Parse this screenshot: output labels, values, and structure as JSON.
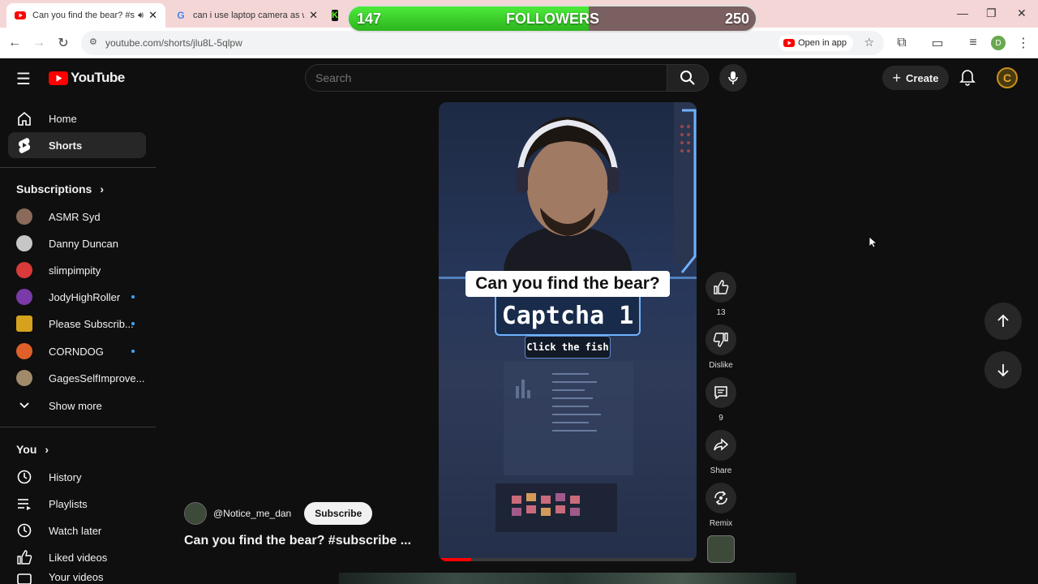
{
  "browser": {
    "tabs": [
      {
        "title": "Can you find the bear? #sub"
      },
      {
        "title": "can i use laptop camera as web"
      }
    ],
    "url": "youtube.com/shorts/jlu8L-5qlpw",
    "open_in_app": "Open in app",
    "profile_initial": "D"
  },
  "followers": {
    "current": "147",
    "label": "FOLLOWERS",
    "goal": "250",
    "progress": 0.59
  },
  "youtube": {
    "logo": "YouTube",
    "search_placeholder": "Search",
    "create_label": "Create"
  },
  "sidebar": {
    "main": [
      {
        "label": "Home",
        "icon": "home-icon"
      },
      {
        "label": "Shorts",
        "icon": "shorts-icon"
      }
    ],
    "subscriptions_heading": "Subscriptions",
    "subscriptions": [
      {
        "label": "ASMR Syd",
        "color": "#8a6a5a",
        "new": false
      },
      {
        "label": "Danny Duncan",
        "color": "#c6c6c6",
        "new": false
      },
      {
        "label": "slimpimpity",
        "color": "#d93a3a",
        "new": false
      },
      {
        "label": "JodyHighRoller",
        "color": "#7a3aa8",
        "new": true
      },
      {
        "label": "Please Subscrib...",
        "color": "#d6a21e",
        "new": true
      },
      {
        "label": "CORNDOG",
        "color": "#e0602a",
        "new": true
      },
      {
        "label": "GagesSelfImprove...",
        "color": "#a08a6a",
        "new": false
      }
    ],
    "show_more": "Show more",
    "you_heading": "You",
    "you_items": [
      {
        "label": "History",
        "icon": "history-icon"
      },
      {
        "label": "Playlists",
        "icon": "playlists-icon"
      },
      {
        "label": "Watch later",
        "icon": "watch-later-icon"
      },
      {
        "label": "Liked videos",
        "icon": "liked-videos-icon"
      },
      {
        "label": "Your videos",
        "icon": "your-videos-icon"
      }
    ]
  },
  "video": {
    "caption": "Can you find the bear?",
    "captcha_title": "Captcha 1",
    "captcha_instruction": "Click the fish",
    "channel": "@Notice_me_dan",
    "subscribe": "Subscribe",
    "title": "Can you find the bear? #subscribe ..."
  },
  "actions": {
    "likes": "13",
    "dislike": "Dislike",
    "comments": "9",
    "share": "Share",
    "remix": "Remix"
  }
}
